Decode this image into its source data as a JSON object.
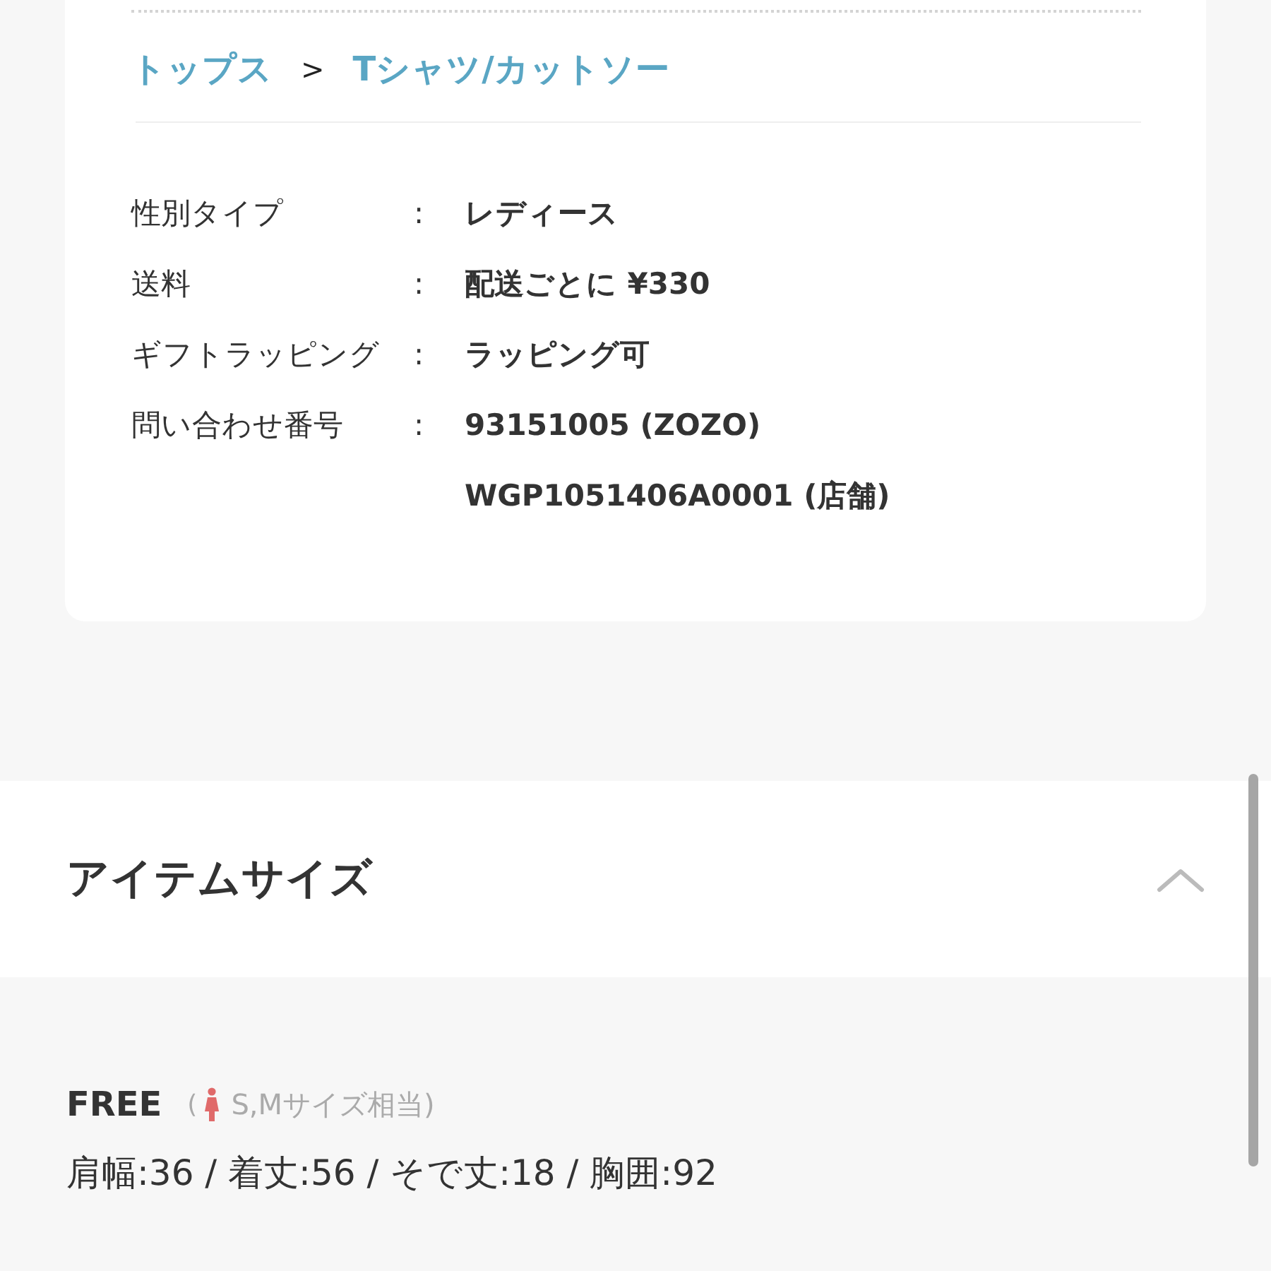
{
  "breadcrumb": [
    "トップス",
    "Tシャツ/カットソー"
  ],
  "breadcrumb_separator": ">",
  "details": [
    {
      "label": "性別タイプ",
      "separator": ":",
      "values": [
        "レディース"
      ]
    },
    {
      "label": "送料",
      "separator": ":",
      "values": [
        "配送ごとに ¥330"
      ]
    },
    {
      "label": "ギフトラッピング",
      "separator": ":",
      "values": [
        "ラッピング可"
      ]
    },
    {
      "label": "問い合わせ番号",
      "separator": ":",
      "values": [
        "93151005 (ZOZO)",
        "WGP1051406A0001 (店舗)"
      ]
    }
  ],
  "item_size": {
    "title": "アイテムサイズ",
    "expanded": true,
    "sizes": [
      {
        "name": "FREE",
        "open_paren": "(",
        "equivalent": "S,Mサイズ相当)",
        "measurements": "肩幅:36 / 着丈:56 / そで丈:18 / 胸囲:92"
      }
    ]
  }
}
